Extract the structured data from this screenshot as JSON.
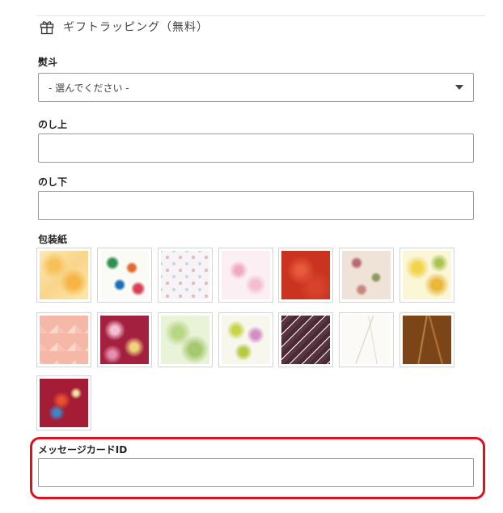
{
  "section": {
    "title": "ギフトラッピング（無料）",
    "icon": "gift-icon"
  },
  "noshi": {
    "label": "熨斗",
    "select_value": "- 選んでください -"
  },
  "noshi_upper": {
    "label": "のし上",
    "value": ""
  },
  "noshi_lower": {
    "label": "のし下",
    "value": ""
  },
  "wrapping": {
    "label": "包装紙",
    "swatch_count": 15
  },
  "message_card": {
    "label": "メッセージカードID",
    "value": ""
  },
  "colors": {
    "highlight": "#e0101e",
    "border": "#999999"
  }
}
